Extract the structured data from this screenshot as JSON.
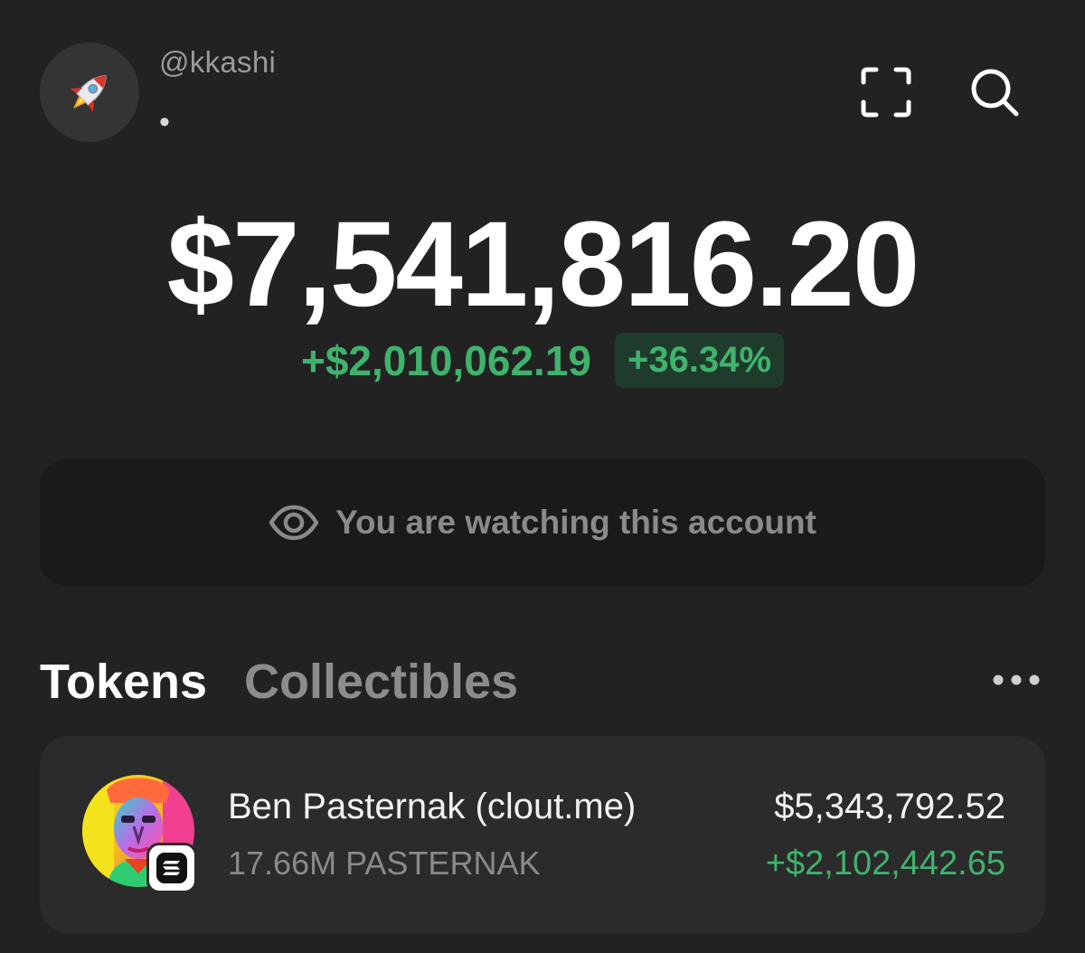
{
  "header": {
    "avatar_icon": "rocket-icon",
    "username": "@kkashi",
    "account_name": "•",
    "scan_icon": "scan-frame-icon",
    "search_icon": "search-icon"
  },
  "balance": {
    "total": "$7,541,816.20",
    "change_amount": "+$2,010,062.19",
    "change_percent": "+36.34%"
  },
  "watch_banner": {
    "icon": "eye-icon",
    "text": "You are watching this account"
  },
  "tabs": [
    {
      "label": "Tokens",
      "active": true
    },
    {
      "label": "Collectibles",
      "active": false
    }
  ],
  "more_icon": "more-horizontal-icon",
  "tokens": [
    {
      "name": "Ben Pasternak (clout.me)",
      "quantity": "17.66M PASTERNAK",
      "value": "$5,343,792.52",
      "change": "+$2,102,442.65",
      "chain_icon": "solana-badge-icon"
    }
  ],
  "colors": {
    "background": "#222222",
    "positive": "#3fb36d",
    "positive_badge_bg": "#1f3b2c",
    "card": "#2b2b2b",
    "banner": "#1a1a1a"
  }
}
